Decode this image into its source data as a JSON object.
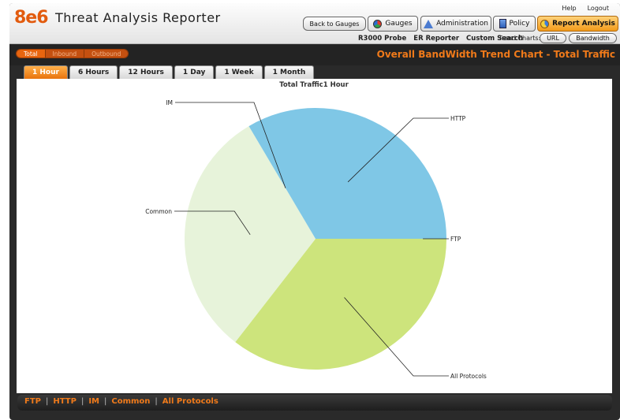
{
  "header": {
    "logo": "8e6",
    "title": "Threat Analysis Reporter",
    "help_label": "Help",
    "logout_label": "Logout",
    "back_button": "Back to Gauges",
    "nav": [
      {
        "label": "Gauges",
        "icon": "gauge-icon"
      },
      {
        "label": "Administration",
        "icon": "admin-icon"
      },
      {
        "label": "Policy",
        "icon": "policy-icon"
      },
      {
        "label": "Report Analysis",
        "icon": "report-icon",
        "active": true
      }
    ],
    "subnav": [
      "R3000 Probe",
      "ER Reporter",
      "Custom Search"
    ],
    "trend_label": "Trend Charts:",
    "trend_buttons": [
      "URL",
      "Bandwidth"
    ]
  },
  "toolbar": {
    "direction_tabs": [
      {
        "label": "Total",
        "active": true
      },
      {
        "label": "Inbound"
      },
      {
        "label": "Outbound"
      }
    ],
    "heading": "Overall BandWidth Trend Chart - Total Traffic"
  },
  "time_tabs": [
    {
      "label": "1 Hour",
      "active": true
    },
    {
      "label": "6 Hours"
    },
    {
      "label": "12 Hours"
    },
    {
      "label": "1 Day"
    },
    {
      "label": "1 Week"
    },
    {
      "label": "1 Month"
    }
  ],
  "chart_data": {
    "type": "pie",
    "title": "Total Traffic1 Hour",
    "slices": [
      {
        "label": "FTP",
        "value": 0,
        "color": "#7fc7e6"
      },
      {
        "label": "All Protocols",
        "value": 35.5,
        "color": "#cde47c"
      },
      {
        "label": "Common",
        "value": 31,
        "color": "#e7f3da"
      },
      {
        "label": "IM",
        "value": 0,
        "color": "#7fc7e6"
      },
      {
        "label": "HTTP",
        "value": 33.5,
        "color": "#7fc7e6"
      }
    ],
    "legend_placement": "callout-labels"
  },
  "legend_bar": [
    "FTP",
    "HTTP",
    "IM",
    "Common",
    "All Protocols"
  ],
  "colors": {
    "accent": "#f07a1a",
    "active_tab": "#e8730d",
    "toolbar_bg": "#232323"
  }
}
